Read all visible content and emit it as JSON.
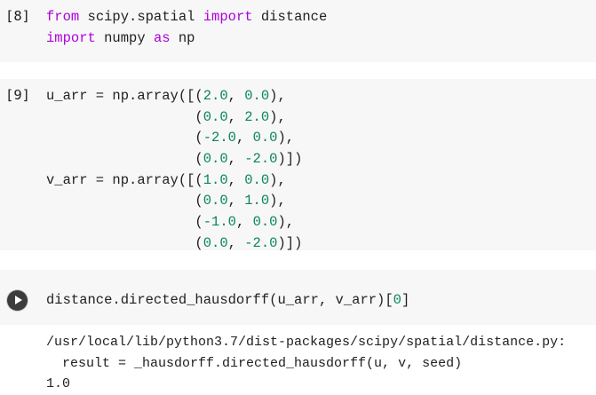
{
  "cells": [
    {
      "prompt": "[8]",
      "lines": [
        {
          "parts": [
            {
              "t": "from",
              "c": "kw"
            },
            {
              "t": " scipy.spatial ",
              "c": "fn"
            },
            {
              "t": "import",
              "c": "kw"
            },
            {
              "t": " distance",
              "c": "fn"
            }
          ]
        },
        {
          "parts": [
            {
              "t": "import",
              "c": "kw"
            },
            {
              "t": " numpy ",
              "c": "fn"
            },
            {
              "t": "as",
              "c": "kw"
            },
            {
              "t": " np",
              "c": "fn"
            }
          ]
        }
      ]
    },
    {
      "prompt": "[9]",
      "lines": [
        {
          "parts": [
            {
              "t": "u_arr = np.array([(",
              "c": "fn"
            },
            {
              "t": "2.0",
              "c": "num"
            },
            {
              "t": ", ",
              "c": "fn"
            },
            {
              "t": "0.0",
              "c": "num"
            },
            {
              "t": "),",
              "c": "fn"
            }
          ]
        },
        {
          "parts": [
            {
              "t": "                  (",
              "c": "fn"
            },
            {
              "t": "0.0",
              "c": "num"
            },
            {
              "t": ", ",
              "c": "fn"
            },
            {
              "t": "2.0",
              "c": "num"
            },
            {
              "t": "),",
              "c": "fn"
            }
          ]
        },
        {
          "parts": [
            {
              "t": "                  (",
              "c": "fn"
            },
            {
              "t": "-2.0",
              "c": "num"
            },
            {
              "t": ", ",
              "c": "fn"
            },
            {
              "t": "0.0",
              "c": "num"
            },
            {
              "t": "),",
              "c": "fn"
            }
          ]
        },
        {
          "parts": [
            {
              "t": "                  (",
              "c": "fn"
            },
            {
              "t": "0.0",
              "c": "num"
            },
            {
              "t": ", ",
              "c": "fn"
            },
            {
              "t": "-2.0",
              "c": "num"
            },
            {
              "t": ")])",
              "c": "fn"
            }
          ]
        },
        {
          "parts": [
            {
              "t": "v_arr = np.array([(",
              "c": "fn"
            },
            {
              "t": "1.0",
              "c": "num"
            },
            {
              "t": ", ",
              "c": "fn"
            },
            {
              "t": "0.0",
              "c": "num"
            },
            {
              "t": "),",
              "c": "fn"
            }
          ]
        },
        {
          "parts": [
            {
              "t": "                  (",
              "c": "fn"
            },
            {
              "t": "0.0",
              "c": "num"
            },
            {
              "t": ", ",
              "c": "fn"
            },
            {
              "t": "1.0",
              "c": "num"
            },
            {
              "t": "),",
              "c": "fn"
            }
          ]
        },
        {
          "parts": [
            {
              "t": "                  (",
              "c": "fn"
            },
            {
              "t": "-1.0",
              "c": "num"
            },
            {
              "t": ", ",
              "c": "fn"
            },
            {
              "t": "0.0",
              "c": "num"
            },
            {
              "t": "),",
              "c": "fn"
            }
          ]
        },
        {
          "parts": [
            {
              "t": "                  (",
              "c": "fn"
            },
            {
              "t": "0.0",
              "c": "num"
            },
            {
              "t": ", ",
              "c": "fn"
            },
            {
              "t": "-2.0",
              "c": "num"
            },
            {
              "t": ")])",
              "c": "fn"
            }
          ]
        }
      ]
    },
    {
      "prompt": "",
      "lines": [
        {
          "parts": [
            {
              "t": "distance.directed_hausdorff(u_arr, v_arr)[",
              "c": "fn"
            },
            {
              "t": "0",
              "c": "num"
            },
            {
              "t": "]",
              "c": "fn"
            }
          ]
        }
      ]
    }
  ],
  "output": {
    "lines": [
      "/usr/local/lib/python3.7/dist-packages/scipy/spatial/distance.py:",
      "  result = _hausdorff.directed_hausdorff(u, v, seed)",
      "1.0"
    ]
  },
  "run_button": {
    "icon": "play-icon"
  }
}
